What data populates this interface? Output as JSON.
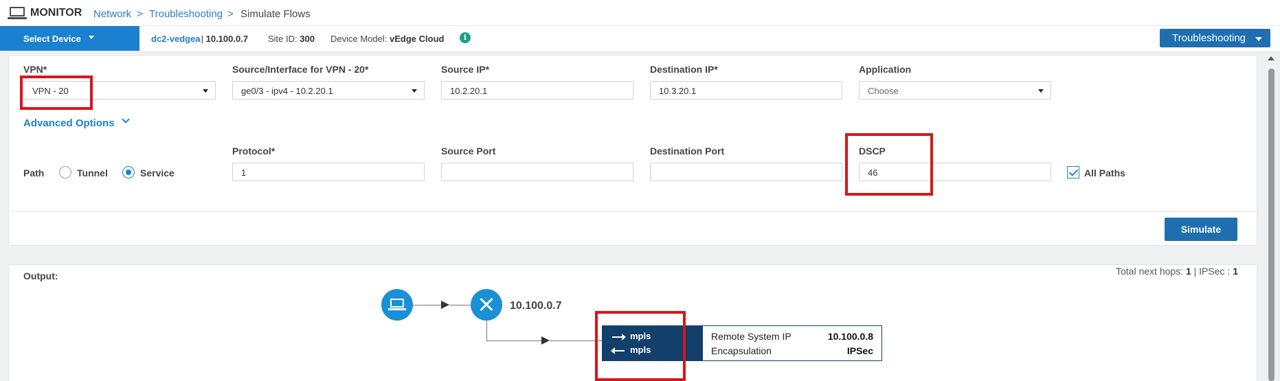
{
  "header": {
    "title": "MONITOR",
    "breadcrumb": [
      "Network",
      "Troubleshooting",
      "Simulate Flows"
    ],
    "separator": ">"
  },
  "device_bar": {
    "select_label": "Select Device",
    "device_name": "dc2-vedgea",
    "device_ip": "10.100.0.7",
    "site_id_label": "Site ID:",
    "site_id_value": "300",
    "model_label": "Device Model:",
    "model_value": "vEdge Cloud",
    "info_icon": "i",
    "troubleshooting_label": "Troubleshooting"
  },
  "form": {
    "vpn": {
      "label": "VPN*",
      "value": "VPN - 20"
    },
    "source_interface": {
      "label": "Source/Interface for VPN - 20*",
      "value": "ge0/3 - ipv4 - 10.2.20.1"
    },
    "source_ip": {
      "label": "Source IP*",
      "value": "10.2.20.1"
    },
    "destination_ip": {
      "label": "Destination IP*",
      "value": "10.3.20.1"
    },
    "application": {
      "label": "Application",
      "value": "Choose"
    },
    "advanced_options": "Advanced Options",
    "path": {
      "label": "Path",
      "options": [
        "Tunnel",
        "Service"
      ],
      "selected": "Service"
    },
    "protocol": {
      "label": "Protocol*",
      "value": "1"
    },
    "source_port": {
      "label": "Source Port",
      "value": ""
    },
    "destination_port": {
      "label": "Destination Port",
      "value": ""
    },
    "dscp": {
      "label": "DSCP",
      "value": "46"
    },
    "all_paths": {
      "label": "All Paths",
      "checked": true
    },
    "simulate_label": "Simulate"
  },
  "output": {
    "label": "Output:",
    "total_hops_label": "Total next hops:",
    "total_hops_value": "1",
    "ipsec_label": "IPSec :",
    "ipsec_value": "1",
    "separator": "|",
    "router_ip": "10.100.0.7",
    "tunnel": {
      "out_color": "mpls",
      "in_color": "mpls",
      "remote_system_ip_label": "Remote System IP",
      "remote_system_ip_value": "10.100.0.8",
      "encapsulation_label": "Encapsulation",
      "encapsulation_value": "IPSec"
    }
  },
  "colors": {
    "accent_blue": "#1b80cf",
    "button_blue": "#1f6fb0",
    "tunnel_navy": "#123f6b",
    "highlight_red": "#d9151c",
    "info_green": "#18a28a"
  },
  "icons": {
    "monitor": "monitor-icon",
    "laptop": "laptop-icon",
    "router": "router-icon",
    "info": "info-icon"
  }
}
